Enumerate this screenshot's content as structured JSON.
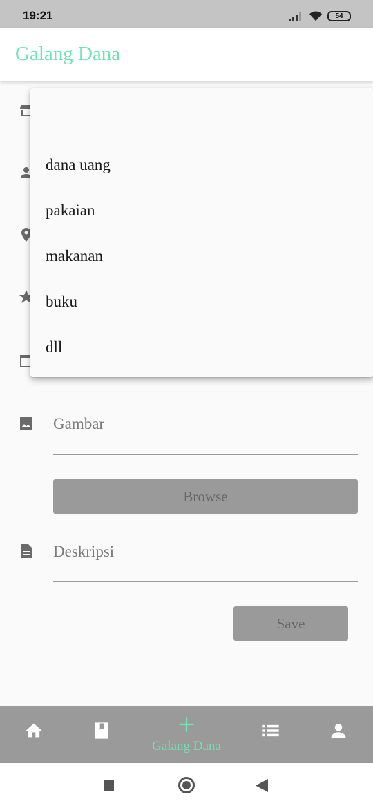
{
  "status_bar": {
    "time": "19:21",
    "battery": "54"
  },
  "app_bar": {
    "title": "Galang Dana"
  },
  "form": {
    "fields": [
      {
        "icon": "store-icon"
      },
      {
        "icon": "person-icon"
      },
      {
        "icon": "location-icon"
      },
      {
        "icon": "star-icon"
      },
      {
        "icon": "calendar-icon"
      },
      {
        "icon": "image-icon",
        "label": "Gambar"
      },
      {
        "icon": "description-icon",
        "label": "Deskripsi"
      }
    ],
    "browse_label": "Browse",
    "save_label": "Save"
  },
  "dropdown": {
    "options": [
      "dana uang",
      "pakaian",
      "makanan",
      "buku",
      "dll"
    ]
  },
  "bottom_nav": {
    "items": [
      {
        "icon": "home-icon"
      },
      {
        "icon": "book-icon"
      },
      {
        "icon": "add-icon",
        "label": "Galang Dana",
        "active": true
      },
      {
        "icon": "list-icon"
      },
      {
        "icon": "profile-icon"
      }
    ]
  },
  "system_nav": {
    "icons": [
      "recent-apps-icon",
      "home-circle-icon",
      "back-icon"
    ]
  },
  "colors": {
    "accent": "#6fe3b2",
    "nav_bg": "#9a9a9a",
    "status_bg": "#c4c4c4"
  }
}
